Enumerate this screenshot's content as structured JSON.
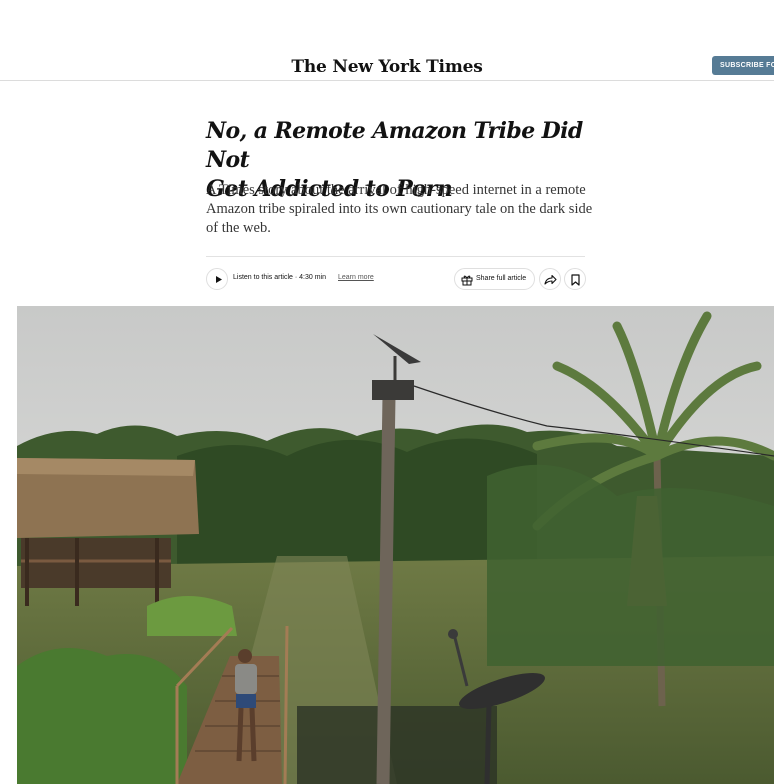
{
  "masthead": {
    "logo_text": "The New York Times",
    "subscribe_label": "SUBSCRIBE FOR"
  },
  "article": {
    "headline_line1": "No, a Remote Amazon Tribe Did Not",
    "headline_line2": "Get Addicted to Porn",
    "summary": "A Times story about the arrival of high-speed internet in a remote Amazon tribe spiraled into its own cautionary tale on the dark side of the web."
  },
  "toolbar": {
    "listen_text": "Listen to this article · 4:30 min",
    "learn_more": "Learn more",
    "share_full_label": "Share full article"
  },
  "icons": {
    "play": "play-icon",
    "gift": "gift-icon",
    "share": "share-arrow-icon",
    "save": "bookmark-icon"
  },
  "colors": {
    "subscribe_bg": "#567b95",
    "text": "#121212"
  }
}
